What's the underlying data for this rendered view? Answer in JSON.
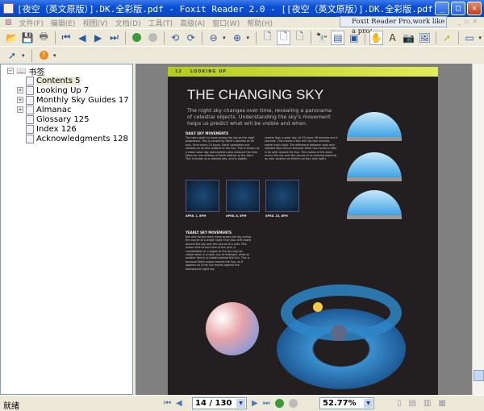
{
  "window": {
    "title": "[夜空（英文原版）].DK.全彩版.pdf - Foxit Reader 2.0 - [[夜空（英文原版）].DK.全彩版.pdf]",
    "minimize": "_",
    "maximize": "□",
    "close": "✕"
  },
  "menu": [
    "文件(F)",
    "编辑(E)",
    "视图(V)",
    "文档(D)",
    "工具(T)",
    "高级(A)",
    "窗口(W)",
    "帮助(H)"
  ],
  "promo": "Foxit Reader Pro,work like a pro!",
  "bookmarks": {
    "root": "书签",
    "items": [
      {
        "label": "Contents 5",
        "expandable": false,
        "selected": true
      },
      {
        "label": "Looking Up 7",
        "expandable": true
      },
      {
        "label": "Monthly Sky Guides 17",
        "expandable": true
      },
      {
        "label": "Almanac",
        "expandable": true
      },
      {
        "label": "Glossary 125",
        "expandable": false
      },
      {
        "label": "Index 126",
        "expandable": false
      },
      {
        "label": "Acknowledgments 128",
        "expandable": false
      }
    ]
  },
  "page": {
    "number": "12",
    "section": "LOOKING UP",
    "title": "THE CHANGING SKY",
    "subtitle": "The night sky changes over time, revealing a panorama of celestial objects. Understanding the sky's movement helps us predict what will be visible and when.",
    "daily_heading": "DAILY SKY MOVEMENTS",
    "daily_col1": "The stars seem to move across the sky as the night progresses. This is caused by Earth's rotation on its axis. Once every 24 hours, Earth completes one rotation on its axis relative to the Sun. This is known as a mean solar day. Astronomers also measure the time taken for one rotation of Earth relative to the stars. This is known as a sidereal day, and is slightly",
    "daily_col2": "shorter than a solar day, at 23 hours 56 minutes and 4 seconds. This means a star will rise four minutes earlier each night. The difference between solar and sidereal days occurs because Earth has moved a little in its orbit around the Sun. The motion of the stars across the sky over the course of an evening depends on your location on Earth's surface (see right).",
    "captions": [
      "APRIL 1, 8PM",
      "APRIL 8, 8PM",
      "APRIL 15, 8PM"
    ],
    "yearly_heading": "YEARLY SKY MOVEMENTS",
    "yearly_text": "Not only do the stars move across the sky during the course of a single night, they also drift slowly around the sky over the course of a year. This means that at one time of the year, a constellation or a region of the sky may be visible when it is dark, say at midnight, while at another time it is hidden behind the Sun. This is because Earth moves around the Sun, so it appears as if the Sun moves against the background night sky."
  },
  "status": {
    "text": "就绪",
    "page": "14 / 130",
    "zoom": "52.77%"
  }
}
